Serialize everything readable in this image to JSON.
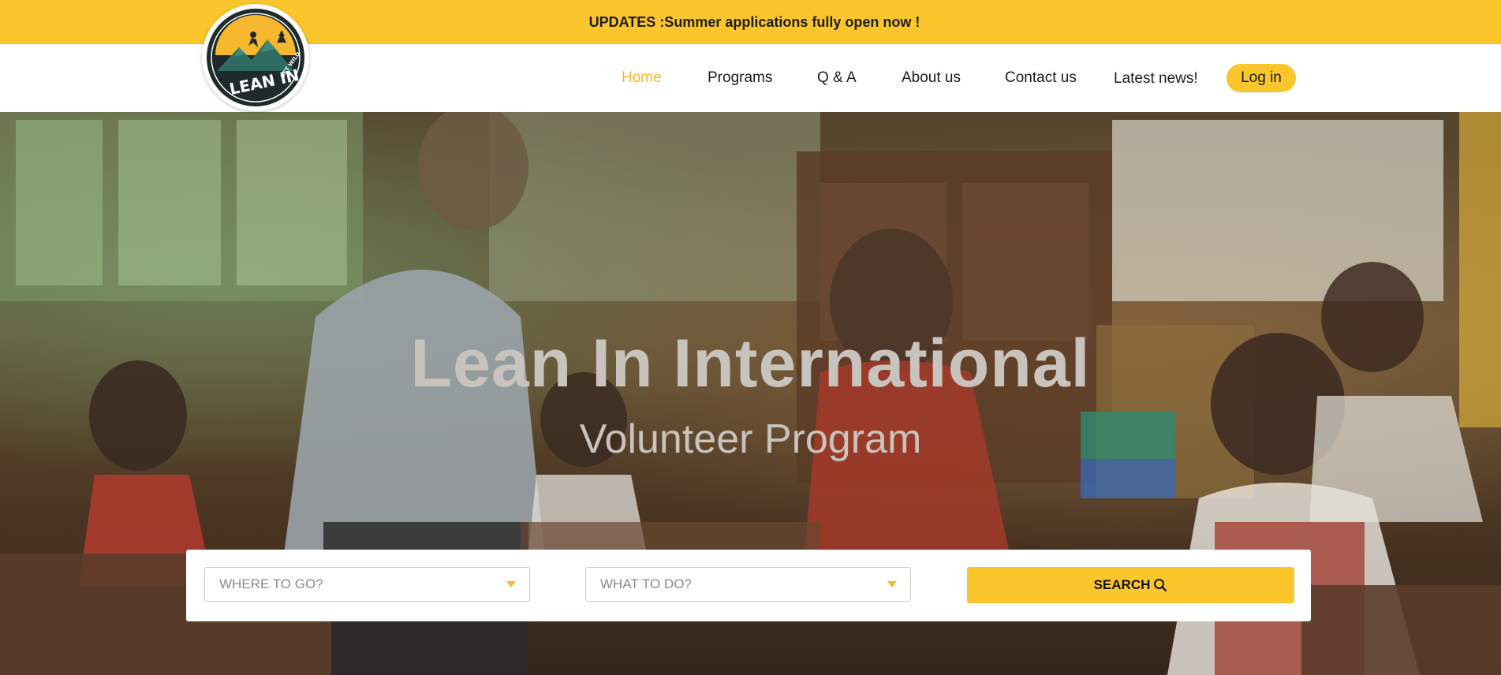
{
  "announcement": {
    "text": "UPDATES :Summer applications fully open now !"
  },
  "logo": {
    "wordmark": "LEAN IN",
    "tagline": "GET WILD",
    "icon": "mountain-hiker-logo"
  },
  "nav": {
    "items": [
      {
        "label": "Home",
        "active": true
      },
      {
        "label": "Programs",
        "active": false
      },
      {
        "label": "Q & A",
        "active": false
      },
      {
        "label": "About us",
        "active": false
      },
      {
        "label": "Contact us",
        "active": false
      },
      {
        "label": "Latest news!",
        "active": false
      }
    ],
    "login_label": "Log in"
  },
  "hero": {
    "title": "Lean In International",
    "subtitle": "Volunteer Program",
    "image": "classroom-teacher-and-students-photo"
  },
  "search": {
    "where": {
      "placeholder": "WHERE TO GO?"
    },
    "what": {
      "placeholder": "WHAT TO DO?"
    },
    "button_label": "SEARCH",
    "button_icon": "search-icon"
  },
  "colors": {
    "accent": "#fbc62b",
    "active_link": "#f5b82e",
    "text": "#1b1b1b"
  }
}
